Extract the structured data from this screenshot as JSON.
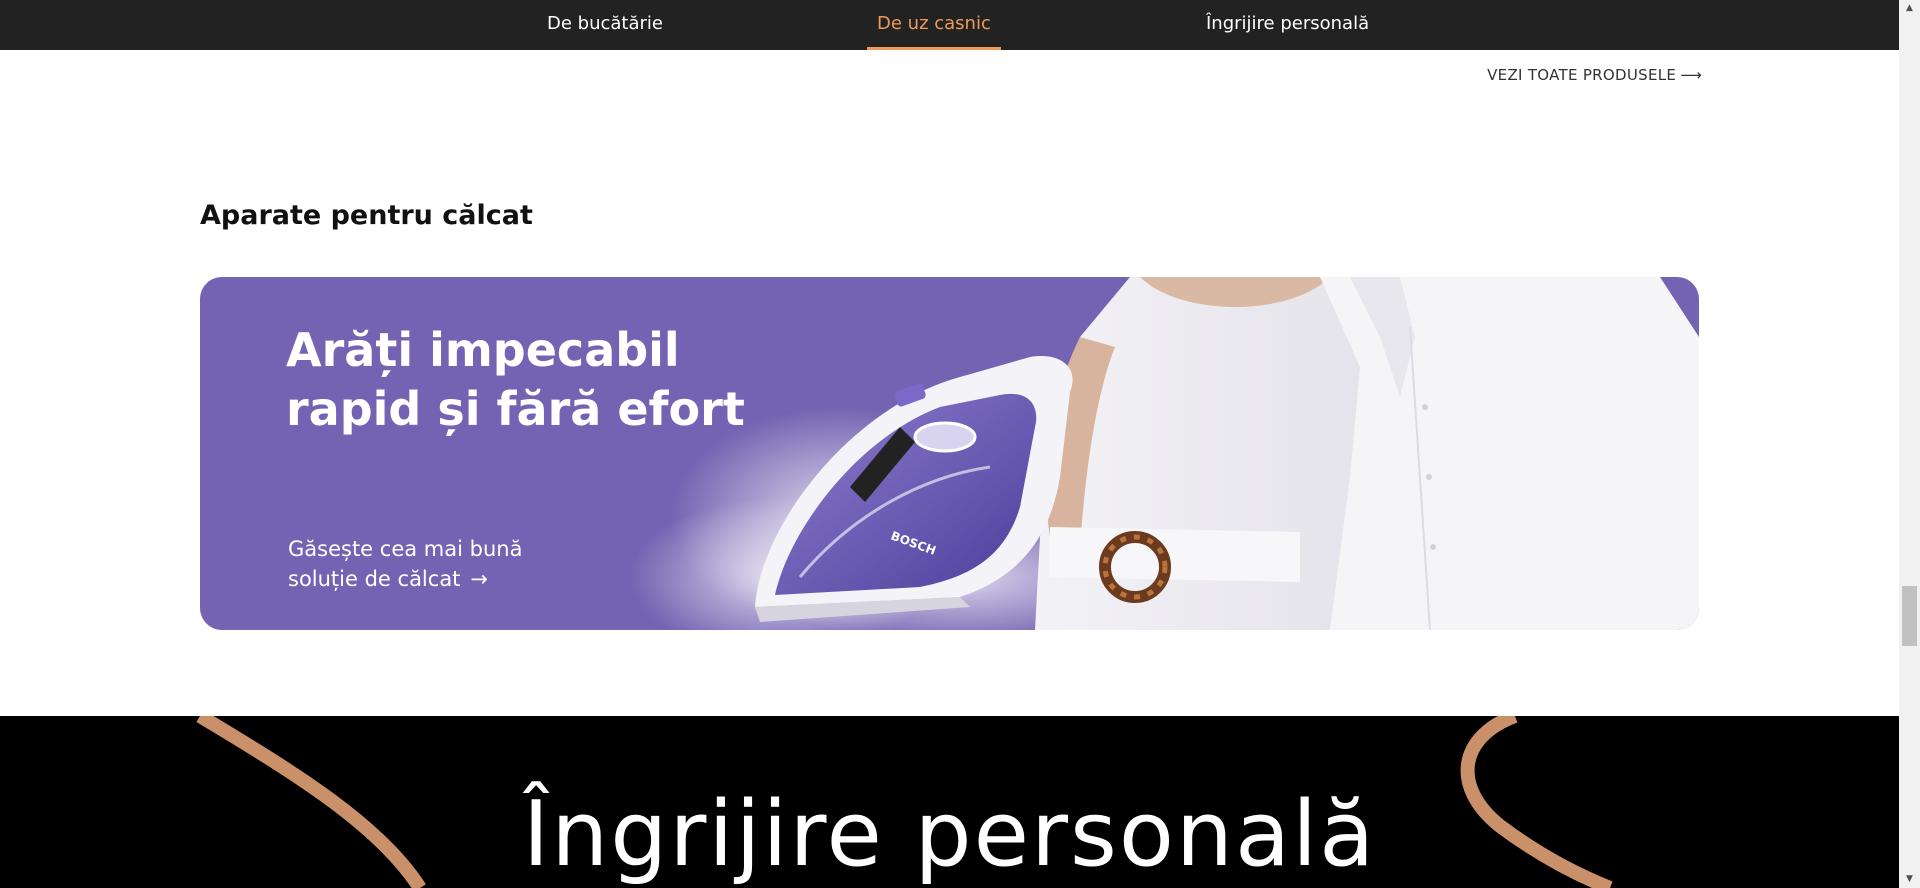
{
  "nav": {
    "tabs": [
      {
        "label": "De bucătărie",
        "active": false
      },
      {
        "label": "De uz casnic",
        "active": true
      },
      {
        "label": "Îngrijire personală",
        "active": false
      }
    ],
    "active_color": "#ef9a5b"
  },
  "view_all": {
    "label": "VEZI TOATE PRODUSELE",
    "arrow": "⟶"
  },
  "section": {
    "title": "Aparate pentru călcat"
  },
  "banner": {
    "headline_line1": "Arăți impecabil",
    "headline_line2": "rapid și fără efort",
    "sub_line1": "Găsește cea mai bună",
    "sub_line2": "soluție de călcat",
    "arrow": "→",
    "brand_on_product": "BOSCH",
    "background_color": "#7463b2"
  },
  "dark_section": {
    "title": "Îngrijire personală",
    "accent_color": "#c9906a"
  },
  "scrollbar": {
    "up": "▲",
    "down": "▼"
  }
}
